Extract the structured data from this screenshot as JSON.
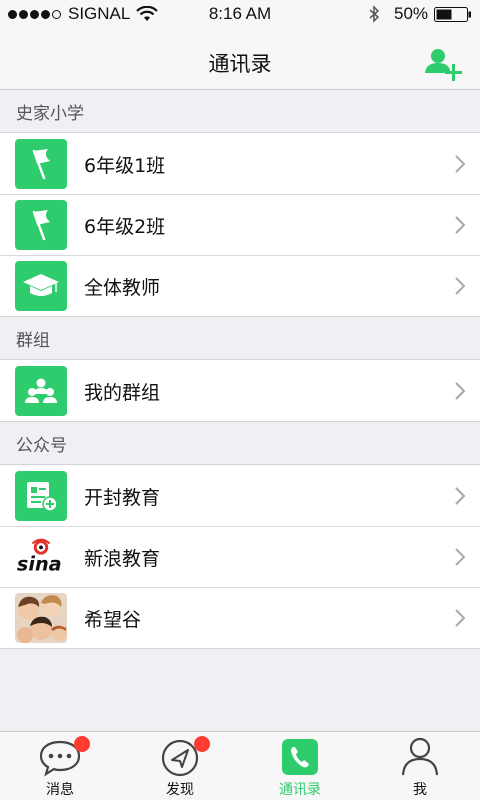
{
  "status_bar": {
    "carrier": "SIGNAL",
    "time": "8:16 AM",
    "battery": "50%"
  },
  "nav": {
    "title": "通讯录",
    "add_contact_icon": "add-contact-icon"
  },
  "sections": [
    {
      "title": "史家小学",
      "items": [
        {
          "label": "6年级1班",
          "icon": "flag-icon"
        },
        {
          "label": "6年级2班",
          "icon": "flag-icon"
        },
        {
          "label": "全体教师",
          "icon": "graduation-cap-icon"
        }
      ]
    },
    {
      "title": "群组",
      "items": [
        {
          "label": "我的群组",
          "icon": "group-icon"
        }
      ]
    },
    {
      "title": "公众号",
      "items": [
        {
          "label": "开封教育",
          "icon": "news-add-icon"
        },
        {
          "label": "新浪教育",
          "icon": "sina-logo-icon"
        },
        {
          "label": "希望谷",
          "icon": "children-photo-icon"
        }
      ]
    }
  ],
  "tabs": [
    {
      "label": "消息",
      "icon": "chat-bubble-icon",
      "badge": true
    },
    {
      "label": "发现",
      "icon": "compass-icon",
      "badge": true
    },
    {
      "label": "通讯录",
      "icon": "phone-icon",
      "active": true
    },
    {
      "label": "我",
      "icon": "person-icon"
    }
  ],
  "colors": {
    "accent": "#2fcc6e",
    "badge": "#ff3b30",
    "background": "#efeff4"
  }
}
